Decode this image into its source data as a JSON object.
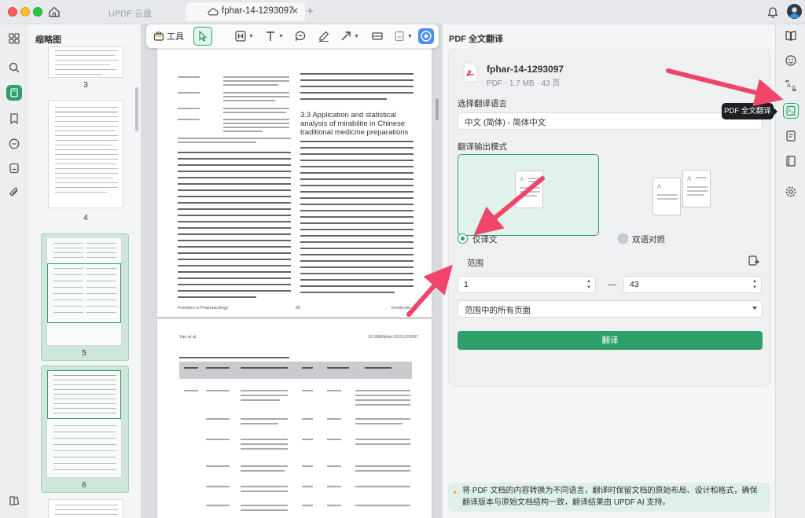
{
  "window": {
    "cloud_tab_label": "UPDF 云盘",
    "doc_tab_label": "fphar-14-1293097",
    "close_glyph": "✕",
    "add_tab_glyph": "+"
  },
  "left_rail": {
    "icons": [
      "grid-icon",
      "search-icon",
      "thumbnail-icon",
      "bookmark-icon",
      "comment-icon",
      "stamp-icon",
      "attachment-icon",
      "layers-icon"
    ]
  },
  "thumbnails": {
    "title": "缩略图",
    "pages": [
      {
        "number": "3"
      },
      {
        "number": "4"
      },
      {
        "number": "5"
      },
      {
        "number": "6"
      }
    ]
  },
  "toolbar": {
    "tool_label": "工具"
  },
  "document": {
    "heading": "3.3 Application and statistical analysis of mirabilite in Chinese traditional medicine preparations",
    "footer_left": "Frontiers in Pharmacology",
    "footer_mid": "05",
    "footer_right": "frontiersin",
    "page2_author": "Yao et al.",
    "page2_doi": "10.3389/fphar.2023.1293097"
  },
  "panel": {
    "title": "PDF 全文翻译",
    "file_name": "fphar-14-1293097",
    "file_meta": "PDF · 1.7 MB · 43 页",
    "language_label": "选择翻译语言",
    "language_value": "中文 (简体) - 简体中文",
    "mode_label": "翻译输出模式",
    "mode_option1": "仅译文",
    "mode_option2": "双语对照",
    "range_label": "范围",
    "range_from": "1",
    "range_to": "43",
    "range_dash": "—",
    "range_type": "范围中的所有页面",
    "translate_button": "翻译",
    "note": "将 PDF 文档的内容转换为不同语言，翻译时保留文档的原始布局、设计和格式，确保翻译版本与原始文档结构一致，翻译结果由 UPDF AI 支持。"
  },
  "right_rail": {
    "tooltip": "PDF 全文翻译",
    "icons": [
      "reader-icon",
      "ai-assistant-icon",
      "translate-icon",
      "pdf-translate-icon",
      "summary-icon",
      "book-icon",
      "settings-icon"
    ]
  },
  "colors": {
    "accent": "#2e9e6b",
    "arrow": "#f0456a"
  }
}
